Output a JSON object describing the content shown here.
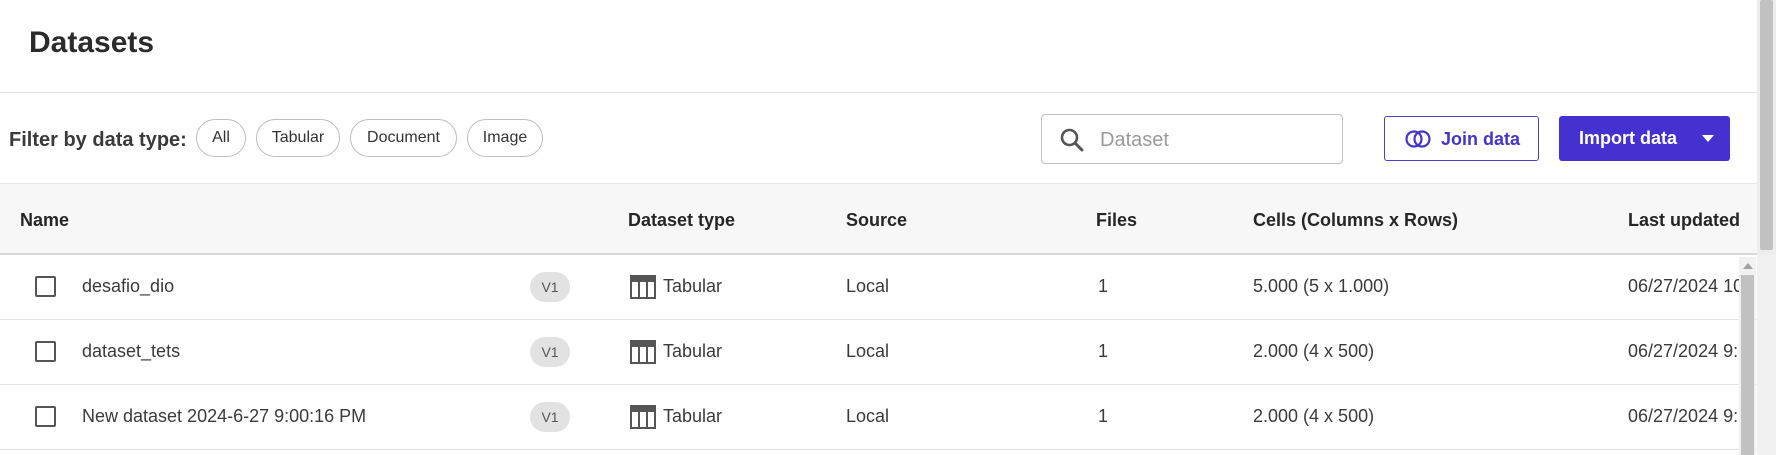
{
  "page": {
    "title": "Datasets"
  },
  "filter": {
    "label": "Filter by data type:",
    "chips": [
      "All",
      "Tabular",
      "Document",
      "Image"
    ]
  },
  "search": {
    "placeholder": "Dataset",
    "value": ""
  },
  "actions": {
    "join_label": "Join data",
    "import_label": "Import data"
  },
  "table": {
    "columns": {
      "name": "Name",
      "dataset_type": "Dataset type",
      "source": "Source",
      "files": "Files",
      "cells": "Cells (Columns x Rows)",
      "last_updated": "Last updated"
    },
    "rows": [
      {
        "name": "desafio_dio",
        "version": "V1",
        "type": "Tabular",
        "source": "Local",
        "files": "1",
        "cells": "5.000 (5 x 1.000)",
        "updated": "06/27/2024 10"
      },
      {
        "name": "dataset_tets",
        "version": "V1",
        "type": "Tabular",
        "source": "Local",
        "files": "1",
        "cells": "2.000 (4 x 500)",
        "updated": "06/27/2024 9:"
      },
      {
        "name": "New dataset 2024-6-27 9:00:16 PM",
        "version": "V1",
        "type": "Tabular",
        "source": "Local",
        "files": "1",
        "cells": "2.000 (4 x 500)",
        "updated": "06/27/2024 9:"
      }
    ]
  },
  "icons": {
    "search": "search-icon",
    "join": "join-circles-icon",
    "import_caret": "caret-down-icon",
    "type": "table-icon"
  },
  "colors": {
    "accent": "#4531d0",
    "accent_text": "#4335c9",
    "badge_bg": "#e2e2e2"
  }
}
